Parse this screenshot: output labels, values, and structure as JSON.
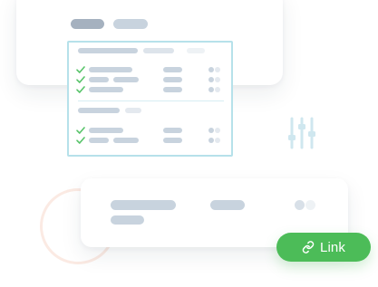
{
  "link_button": {
    "label": "Link",
    "icon": "link-icon"
  },
  "colors": {
    "accent_green": "#4cbc58",
    "selection_border": "#b6e1ea",
    "placeholder_dark": "#a5b1bf",
    "placeholder": "#c8d3de",
    "placeholder_light": "#e4e9ef",
    "check_green": "#58c46a",
    "icon_teal": "#cfe7ef",
    "ring": "#fbeae3"
  },
  "icons": [
    "check-icon",
    "sliders-icon",
    "link-icon"
  ]
}
